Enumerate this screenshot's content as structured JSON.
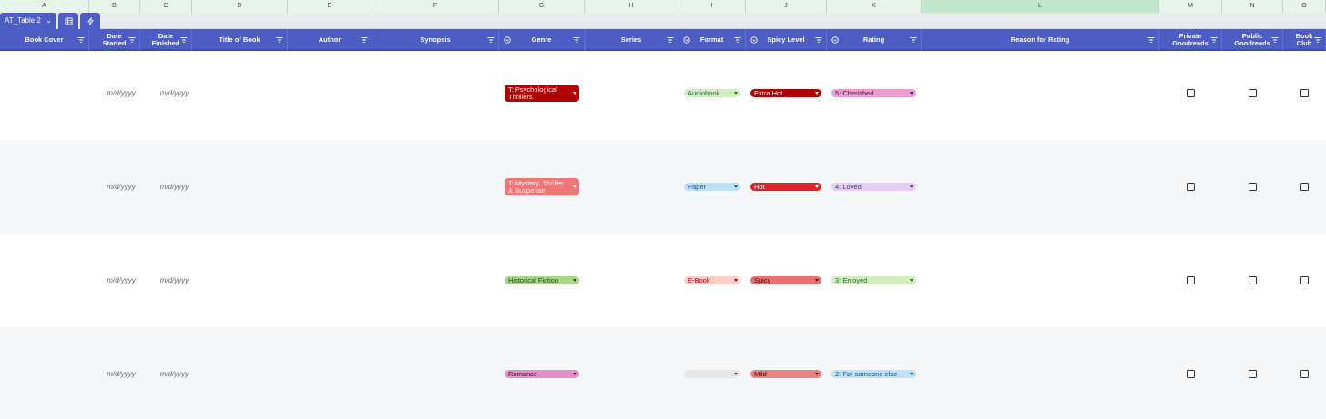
{
  "column_letters": [
    "A",
    "B",
    "C",
    "D",
    "E",
    "F",
    "G",
    "H",
    "I",
    "J",
    "K",
    "L",
    "M",
    "N",
    "O"
  ],
  "table_tab": {
    "name": "AT_Table 2",
    "icons": [
      "table-icon",
      "lightning-icon"
    ]
  },
  "headers": [
    {
      "label": "Book Cover"
    },
    {
      "label": "Date Started"
    },
    {
      "label": "Date Finished"
    },
    {
      "label": "Title of Book"
    },
    {
      "label": "Author"
    },
    {
      "label": "Synopsis"
    },
    {
      "label": "Genre"
    },
    {
      "label": "Series"
    },
    {
      "label": "Format"
    },
    {
      "label": "Spicy Level"
    },
    {
      "label": "Rating"
    },
    {
      "label": "Reason for Rating"
    },
    {
      "label": "Private Goodreads"
    },
    {
      "label": "Public Goodreads"
    },
    {
      "label": "Book Club"
    }
  ],
  "rows": [
    {
      "date_started": "m/d/yyyy",
      "date_finished": "m/d/yyyy",
      "genre": {
        "label": "T: Psychological Thrillers",
        "bg": "#b10202",
        "fg": "#ffffff"
      },
      "format": {
        "label": "Audiobook",
        "bg": "#d4edbc",
        "fg": "#11734b"
      },
      "spicy": {
        "label": "Extra Hot",
        "bg": "#b10202",
        "fg": "#ffffff"
      },
      "rating": {
        "label": "5: Cherished",
        "bg": "#f09ad2",
        "fg": "#4a1a3a"
      },
      "private_goodreads": false,
      "public_goodreads": false,
      "book_club": false
    },
    {
      "date_started": "m/d/yyyy",
      "date_finished": "m/d/yyyy",
      "genre": {
        "label": "T: Mystery, Thriller & Suspense",
        "bg": "#f07677",
        "fg": "#ffffff"
      },
      "format": {
        "label": "Paper",
        "bg": "#bfe1f6",
        "fg": "#0a53a8"
      },
      "spicy": {
        "label": "Hot",
        "bg": "#e32227",
        "fg": "#ffffff"
      },
      "rating": {
        "label": "4: Loved",
        "bg": "#e6cff2",
        "fg": "#5a3286"
      },
      "private_goodreads": false,
      "public_goodreads": false,
      "book_club": false
    },
    {
      "date_started": "m/d/yyyy",
      "date_finished": "m/d/yyyy",
      "genre": {
        "label": "Historical Fiction",
        "bg": "#a9d58a",
        "fg": "#1e4d12"
      },
      "format": {
        "label": "E-Book",
        "bg": "#ffcfc9",
        "fg": "#b10202"
      },
      "spicy": {
        "label": "Spicy",
        "bg": "#ec7072",
        "fg": "#3a0303"
      },
      "rating": {
        "label": "3: Enjoyed",
        "bg": "#d4edbc",
        "fg": "#11734b"
      },
      "private_goodreads": false,
      "public_goodreads": false,
      "book_club": false
    },
    {
      "date_started": "m/d/yyyy",
      "date_finished": "m/d/yyyy",
      "genre": {
        "label": "Romance",
        "bg": "#e98dc6",
        "fg": "#3a0d2b"
      },
      "format": {
        "label": "",
        "bg": "#e8e8e8",
        "fg": "#444444"
      },
      "spicy": {
        "label": "Mild",
        "bg": "#f08080",
        "fg": "#3a0303"
      },
      "rating": {
        "label": "2: For someone else",
        "bg": "#bfe1f6",
        "fg": "#0a53a8"
      },
      "private_goodreads": false,
      "public_goodreads": false,
      "book_club": false
    }
  ]
}
